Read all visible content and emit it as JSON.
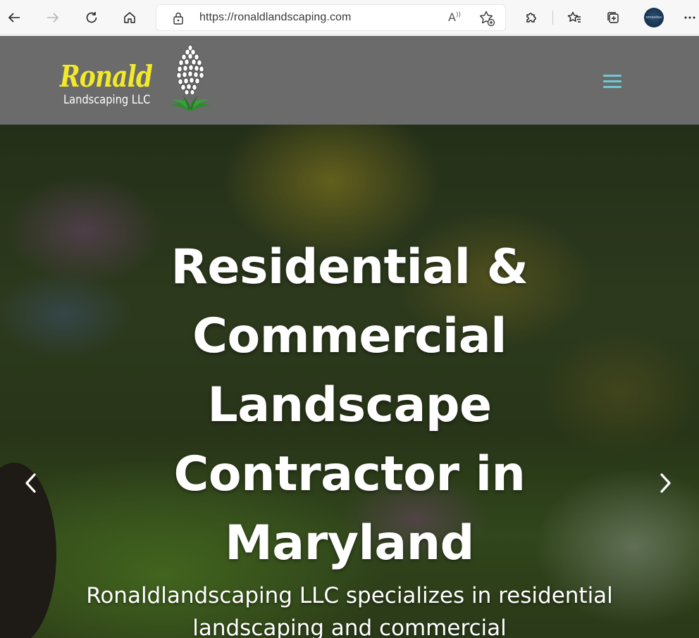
{
  "browser": {
    "url": "https://ronaldlandscaping.com",
    "read_aloud_glyph": "Â)",
    "profile_text": "emesdev"
  },
  "site": {
    "logo": {
      "title": "Ronald",
      "subtitle": "Landscaping LLC"
    },
    "menu_icon": "hamburger-icon"
  },
  "hero": {
    "title": "Residential & Commercial Landscape Contractor in Maryland",
    "subtitle": "Ronaldlandscaping LLC specializes in residential landscaping and commercial",
    "prev_icon": "chevron-left-icon",
    "next_icon": "chevron-right-icon"
  },
  "colors": {
    "header_bg": "#6b6b6b",
    "logo_yellow": "#f2e92a",
    "menu_accent": "#6ec9d1"
  }
}
